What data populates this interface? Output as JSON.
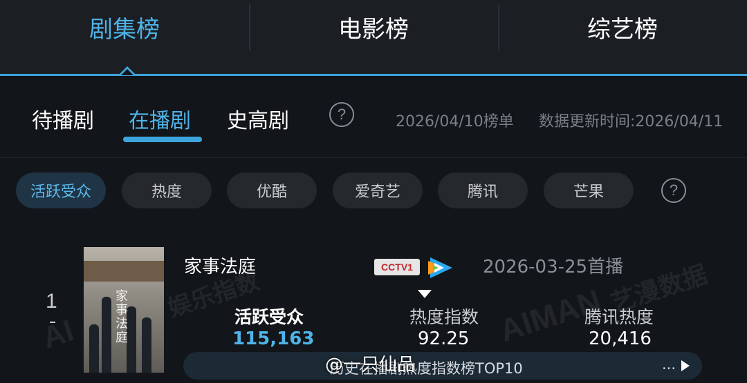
{
  "top_tabs": [
    {
      "label": "剧集榜",
      "active": true
    },
    {
      "label": "电影榜",
      "active": false
    },
    {
      "label": "综艺榜",
      "active": false
    }
  ],
  "sub_tabs": [
    {
      "label": "待播剧",
      "active": false
    },
    {
      "label": "在播剧",
      "active": true
    },
    {
      "label": "史高剧",
      "active": false
    }
  ],
  "help_glyph": "?",
  "list_date": "2026/04/10榜单",
  "update_time": "数据更新时间:2026/04/11",
  "chips": [
    {
      "label": "活跃受众",
      "active": true
    },
    {
      "label": "热度",
      "active": false
    },
    {
      "label": "优酷",
      "active": false
    },
    {
      "label": "爱奇艺",
      "active": false
    },
    {
      "label": "腾讯",
      "active": false
    },
    {
      "label": "芒果",
      "active": false
    }
  ],
  "rank_item": {
    "rank": "1",
    "poster_title": "家事法庭",
    "title": "家事法庭",
    "cctv_logo_text": "CCTV1",
    "platform_icon": "tencent-video-icon",
    "premiere": "2026-03-25首播",
    "stats": [
      {
        "label": "活跃受众",
        "value": "115,163"
      },
      {
        "label": "热度指数",
        "value": "92.25"
      },
      {
        "label": "腾讯热度",
        "value": "20,416"
      }
    ]
  },
  "banner": {
    "text": "历史在播剧热度指数榜TOP10",
    "more": "..."
  },
  "watermark_user": "@一只仙品",
  "brand_watermarks": [
    "AI",
    "娱乐指数",
    "AIMAN",
    "艺漫数据"
  ],
  "colors": {
    "accent": "#3ea5dc",
    "background": "#121519",
    "tab_bar": "#1b1e23"
  }
}
